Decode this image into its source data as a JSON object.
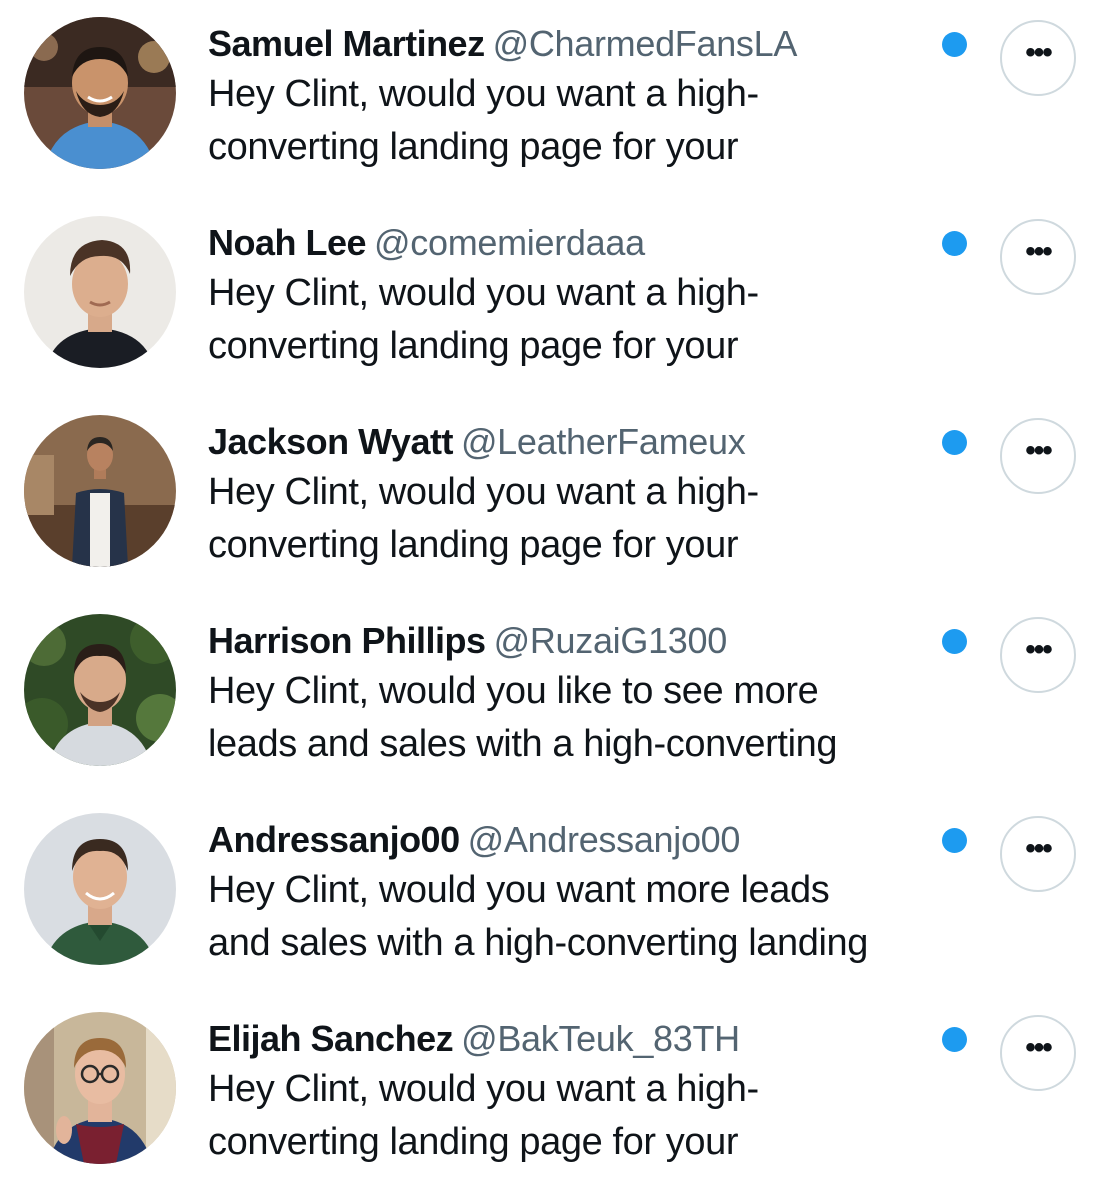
{
  "accent_color": "#1d9bf0",
  "more_button": {
    "icon": "more-horizontal-icon",
    "glyph": "•••"
  },
  "conversations": [
    {
      "name": "Samuel Martinez",
      "handle": "@CharmedFansLA",
      "preview_lines": [
        "Hey Clint, would you want a high-",
        "converting landing page for your"
      ],
      "unread": true
    },
    {
      "name": "Noah Lee",
      "handle": "@comemierdaaa",
      "preview_lines": [
        "Hey Clint, would you want a high-",
        "converting landing page for your"
      ],
      "unread": true
    },
    {
      "name": "Jackson Wyatt",
      "handle": "@LeatherFameux",
      "preview_lines": [
        "Hey Clint, would you want a high-",
        "converting landing page for your"
      ],
      "unread": true
    },
    {
      "name": "Harrison Phillips",
      "handle": "@RuzaiG1300",
      "preview_lines": [
        "Hey Clint, would you like to see more",
        "leads and sales with a high-converting"
      ],
      "unread": true
    },
    {
      "name": "Andressanjo00",
      "handle": "@Andressanjo00",
      "preview_lines": [
        "Hey Clint, would you want more leads",
        "and sales with a high-converting landing"
      ],
      "unread": true
    },
    {
      "name": "Elijah Sanchez",
      "handle": "@BakTeuk_83TH",
      "preview_lines": [
        "Hey Clint, would you want a high-",
        "converting landing page for your"
      ],
      "unread": true
    }
  ]
}
